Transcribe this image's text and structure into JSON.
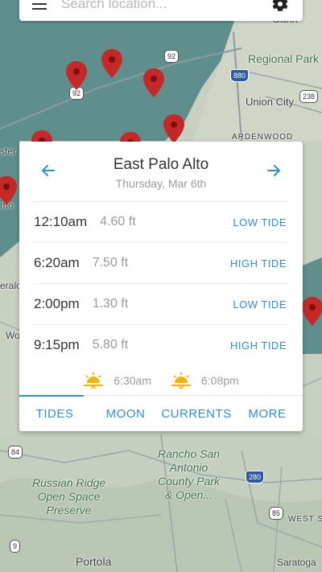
{
  "search": {
    "placeholder": "Search location..."
  },
  "card": {
    "title": "East Palo Alto",
    "date": "Thursday, Mar 6th",
    "tides": [
      {
        "time": "12:10am",
        "height": "4.60 ft",
        "type": "LOW TIDE"
      },
      {
        "time": "6:20am",
        "height": "7.50 ft",
        "type": "HIGH TIDE"
      },
      {
        "time": "2:00pm",
        "height": "1.30 ft",
        "type": "LOW TIDE"
      },
      {
        "time": "9:15pm",
        "height": "5.80 ft",
        "type": "HIGH TIDE"
      }
    ],
    "sunrise": "6:30am",
    "sunset": "6:08pm",
    "tabs": [
      "TIDES",
      "MOON",
      "CURRENTS",
      "MORE"
    ],
    "active_tab": "TIDES"
  },
  "map": {
    "labels": {
      "garin": "Garin",
      "garin_park": "Regional Park",
      "union_city": "Union City",
      "ardenwood": "ARDENWOOD",
      "rancho": "Rancho San Antonio County Park & Open...",
      "rancho_l1": "Rancho San",
      "rancho_l2": "Antonio",
      "rancho_l3": "County Park",
      "rancho_l4": "& Open...",
      "russian_l1": "Russian Ridge",
      "russian_l2": "Open Space",
      "russian_l3": "Preserve",
      "portola": "Portola",
      "west_s": "WEST S",
      "saratoga": "Saratoga",
      "edge_mo": "mo",
      "edge_ster": "ster",
      "edge_eral": "eralo",
      "edge_wo": "Wo"
    },
    "shields": {
      "r92a": "92",
      "r92b": "92",
      "r880": "880",
      "r238": "238",
      "r84": "84",
      "r280": "280",
      "r85": "85",
      "r9": "9"
    },
    "colors": {
      "water": "#5e8f8c",
      "land": "#c8d1c1",
      "pin": "#c62828",
      "accent": "#2d8de0",
      "sun": "#f5b400"
    }
  }
}
